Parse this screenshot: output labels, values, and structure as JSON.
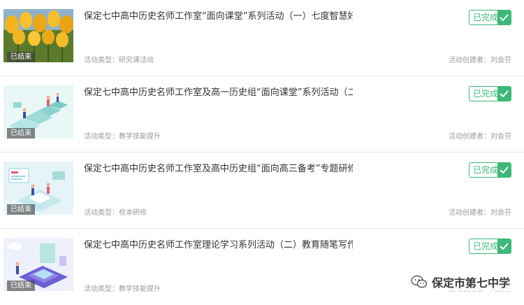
{
  "items": [
    {
      "title": "保定七中高中历史名师工作室“面向课堂”系列活动（一）七度智慧好…",
      "status": "已结束",
      "action": "已完成",
      "type_label": "活动类型：",
      "type_value": "研究课活动",
      "creator_label": "活动创建者：",
      "creator_value": "刘会芬",
      "thumb": "tulip-field-photo"
    },
    {
      "title": "保定七中高中历史名师工作室及高一历史组“面向课堂”系列活动（二…",
      "status": "已结束",
      "action": "已完成",
      "type_label": "活动类型：",
      "type_value": "教学技能提升",
      "creator_label": "活动创建者：",
      "creator_value": "刘会芬",
      "thumb": "isometric-stairs-illustration"
    },
    {
      "title": "保定七中高中历史名师工作室及高中历史组“面向高三备考”专题研修…",
      "status": "已结束",
      "action": "已完成",
      "type_label": "活动类型：",
      "type_value": "校本研修",
      "creator_label": "活动创建者：",
      "creator_value": "刘会芬",
      "thumb": "isometric-meeting-illustration"
    },
    {
      "title": "保定七中高中历史名师工作室理论学习系列活动（二）教育随笔写作…",
      "status": "已结束",
      "action": "已完成",
      "type_label": "活动类型：",
      "type_value": "教学技能提升",
      "creator_label": "活动创建者：",
      "creator_value": "刘会芬",
      "thumb": "isometric-book-illustration"
    }
  ],
  "watermark": {
    "text": "保定市第七中学",
    "icon": "wechat-logo-icon"
  },
  "colors": {
    "accent": "#3cb878",
    "meta_text": "#9a9a9a",
    "divider": "#e6e6e6"
  }
}
